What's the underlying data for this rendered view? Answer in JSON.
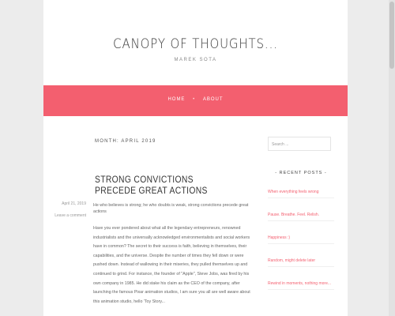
{
  "site": {
    "title": "CANOPY OF THOUGHTS...",
    "description": "MAREK SOTA"
  },
  "nav": {
    "items": [
      {
        "label": "HOME"
      },
      {
        "label": "ABOUT"
      }
    ],
    "separator": "•"
  },
  "archive": {
    "title": "MONTH: APRIL 2019"
  },
  "post": {
    "title": "STRONG CONVICTIONS PRECEDE GREAT ACTIONS",
    "date": "April 21, 2019",
    "comments": "Leave a comment",
    "lead": "He who believes is strong; he who doubts is weak, strong convictions precede great actions",
    "body": "Have you ever pondered about what all the legendary entrepreneurs, renowned industrialists and the universally acknowledged environmentalists and social workers have in common? The secret to their success is faith, believing in themselves, their capabilities, and the universe. Despite the number of times they fell down or were pushed down. Instead of wallowing in their miseries, they pulled themselves up and continued to grind. For instance, the founder of \"Apple\", Steve Jobs, was fired by his own company in 1985. He did stake his claim as the CEO of the company, after launching the famous Pixar animation studios, I am sure you all are well aware about this animation studio, hello 'Toy Story..."
  },
  "sidebar": {
    "search_placeholder": "Search ...",
    "recent_posts_title": "- RECENT POSTS -",
    "recent_posts": [
      "When everything feels wrong",
      "Pause. Breathe. Feel. Relish.",
      "Happiness :)",
      "Random, might delete later",
      "Rewind in moments, nothing more..."
    ]
  },
  "colors": {
    "accent": "#f35f6f",
    "background": "#ececec",
    "page": "#ffffff"
  }
}
